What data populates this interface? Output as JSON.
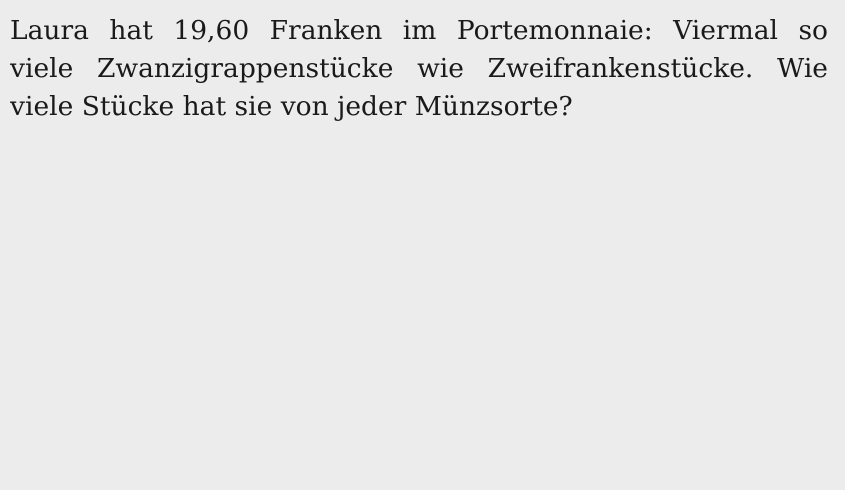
{
  "document": {
    "lines": [
      "Laura hat 19,60 Franken im Portemonnaie: Viermal so",
      "viele Zwanzigrappenstücke wie Zweifrankenstücke. Wie",
      "viele Stücke hat sie von jeder Münzsorte?"
    ]
  },
  "colors": {
    "background": "#ececec",
    "text": "#1a1a1a"
  }
}
